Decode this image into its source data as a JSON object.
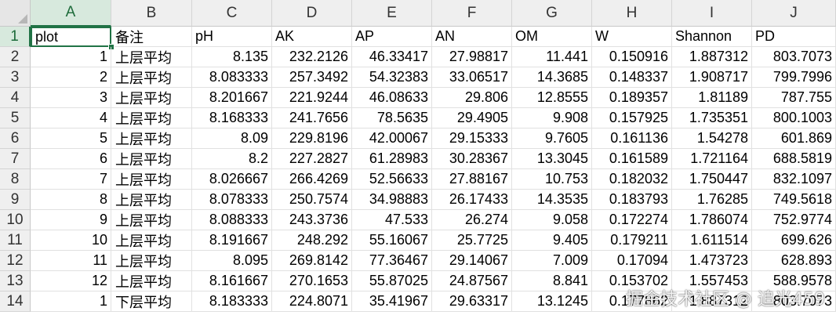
{
  "columns": [
    "A",
    "B",
    "C",
    "D",
    "E",
    "F",
    "G",
    "H",
    "I",
    "J"
  ],
  "rows": [
    "1",
    "2",
    "3",
    "4",
    "5",
    "6",
    "7",
    "8",
    "9",
    "10",
    "11",
    "12",
    "13",
    "14"
  ],
  "headers": [
    "plot",
    "备注",
    "pH",
    "AK",
    "AP",
    "AN",
    "OM",
    "W",
    "Shannon",
    "PD"
  ],
  "data": [
    [
      "1",
      "上层平均",
      "8.135",
      "232.2126",
      "46.33417",
      "27.98817",
      "11.441",
      "0.150916",
      "1.887312",
      "803.7073"
    ],
    [
      "2",
      "上层平均",
      "8.083333",
      "257.3492",
      "54.32383",
      "33.06517",
      "14.3685",
      "0.148337",
      "1.908717",
      "799.7996"
    ],
    [
      "3",
      "上层平均",
      "8.201667",
      "221.9244",
      "46.08633",
      "29.806",
      "12.8555",
      "0.189357",
      "1.81189",
      "787.755"
    ],
    [
      "4",
      "上层平均",
      "8.168333",
      "241.7656",
      "78.5635",
      "29.4905",
      "9.908",
      "0.157925",
      "1.735351",
      "800.1003"
    ],
    [
      "5",
      "上层平均",
      "8.09",
      "229.8196",
      "42.00067",
      "29.15333",
      "9.7605",
      "0.161136",
      "1.54278",
      "601.869"
    ],
    [
      "6",
      "上层平均",
      "8.2",
      "227.2827",
      "61.28983",
      "30.28367",
      "13.3045",
      "0.161589",
      "1.721164",
      "688.5819"
    ],
    [
      "7",
      "上层平均",
      "8.026667",
      "266.4269",
      "52.56633",
      "27.88167",
      "10.753",
      "0.182032",
      "1.750447",
      "832.1097"
    ],
    [
      "8",
      "上层平均",
      "8.078333",
      "250.7574",
      "34.98883",
      "26.17433",
      "14.3535",
      "0.183793",
      "1.76285",
      "749.5618"
    ],
    [
      "9",
      "上层平均",
      "8.088333",
      "243.3736",
      "47.533",
      "26.274",
      "9.058",
      "0.172274",
      "1.786074",
      "752.9774"
    ],
    [
      "10",
      "上层平均",
      "8.191667",
      "248.292",
      "55.16067",
      "25.7725",
      "9.405",
      "0.179211",
      "1.611514",
      "699.626"
    ],
    [
      "11",
      "上层平均",
      "8.095",
      "269.8142",
      "77.36467",
      "29.14067",
      "7.009",
      "0.17094",
      "1.473723",
      "628.893"
    ],
    [
      "12",
      "上层平均",
      "8.161667",
      "270.1653",
      "55.87025",
      "24.87567",
      "8.841",
      "0.153702",
      "1.557453",
      "588.9578"
    ],
    [
      "1",
      "下层平均",
      "8.183333",
      "224.8071",
      "35.41967",
      "29.63317",
      "13.1245",
      "0.177862",
      "1.887312",
      "803.7073"
    ]
  ],
  "watermark": "掘金技术社区 @ 追光459",
  "colors": {
    "accent": "#217346",
    "header_bg": "#efefef",
    "active_header_bg": "#d7e9dd",
    "gridline": "#e1e1e1"
  }
}
